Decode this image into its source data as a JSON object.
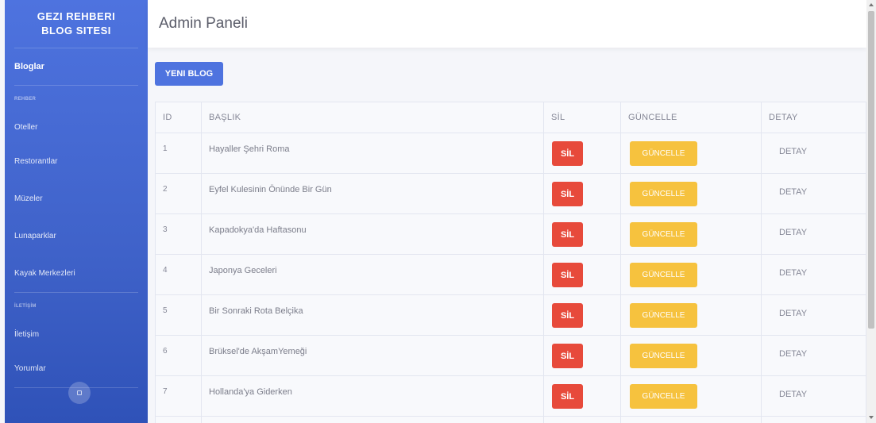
{
  "sidebar": {
    "brand_line1": "GEZI REHBERI",
    "brand_line2": "BLOG SITESI",
    "active_item": "Bloglar",
    "section_rehber": "REHBER",
    "rehber_items": [
      "Oteller",
      "Restorantlar",
      "Müzeler",
      "Lunaparklar",
      "Kayak Merkezleri"
    ],
    "section_iletisim": "İLETİŞİM",
    "iletisim_items": [
      "İletişim",
      "Yorumlar"
    ]
  },
  "header": {
    "title": "Admin Paneli"
  },
  "toolbar": {
    "new_blog_label": "YENI BLOG"
  },
  "table": {
    "columns": [
      "ID",
      "BAŞLIK",
      "SİL",
      "GÜNCELLE",
      "DETAY"
    ],
    "rows": [
      {
        "id": "1",
        "title": "Hayaller Şehri Roma",
        "delete": "SİL",
        "update": "GÜNCELLE",
        "detail": "DETAY"
      },
      {
        "id": "2",
        "title": "Eyfel Kulesinin Önünde Bir Gün",
        "delete": "SİL",
        "update": "GÜNCELLE",
        "detail": "DETAY"
      },
      {
        "id": "3",
        "title": "Kapadokya'da Haftasonu",
        "delete": "SİL",
        "update": "GÜNCELLE",
        "detail": "DETAY"
      },
      {
        "id": "4",
        "title": "Japonya Geceleri",
        "delete": "SİL",
        "update": "GÜNCELLE",
        "detail": "DETAY"
      },
      {
        "id": "5",
        "title": "Bir Sonraki Rota Belçika",
        "delete": "SİL",
        "update": "GÜNCELLE",
        "detail": "DETAY"
      },
      {
        "id": "6",
        "title": "Brüksel'de AkşamYemeği",
        "delete": "SİL",
        "update": "GÜNCELLE",
        "detail": "DETAY"
      },
      {
        "id": "7",
        "title": "Hollanda'ya Giderken",
        "delete": "SİL",
        "update": "GÜNCELLE",
        "detail": "DETAY"
      }
    ]
  },
  "colors": {
    "primary": "#4e73df",
    "danger": "#e74a3b",
    "warning": "#f6c23e",
    "text_muted": "#858796"
  },
  "icons": {
    "sidebar_toggle": "sidebar-toggle-icon"
  }
}
